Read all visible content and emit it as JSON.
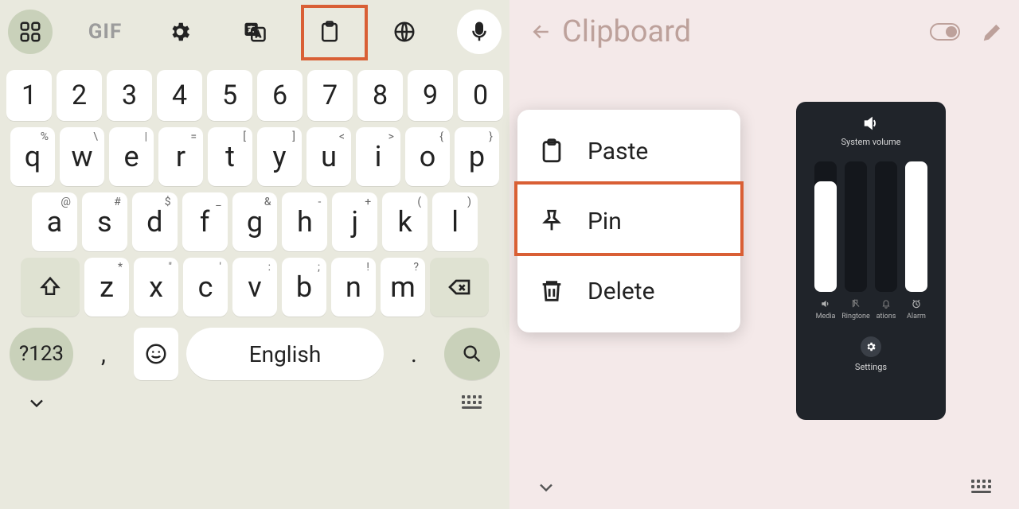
{
  "toolbar": {
    "gif_label": "GIF"
  },
  "keyboard": {
    "row1": [
      "1",
      "2",
      "3",
      "4",
      "5",
      "6",
      "7",
      "8",
      "9",
      "0"
    ],
    "row2": [
      {
        "k": "q",
        "h": "%"
      },
      {
        "k": "w",
        "h": "\\"
      },
      {
        "k": "e",
        "h": "|"
      },
      {
        "k": "r",
        "h": "="
      },
      {
        "k": "t",
        "h": "["
      },
      {
        "k": "y",
        "h": "]"
      },
      {
        "k": "u",
        "h": "<"
      },
      {
        "k": "i",
        "h": ">"
      },
      {
        "k": "o",
        "h": "{"
      },
      {
        "k": "p",
        "h": "}"
      }
    ],
    "row3": [
      {
        "k": "a",
        "h": "@"
      },
      {
        "k": "s",
        "h": "#"
      },
      {
        "k": "d",
        "h": "$"
      },
      {
        "k": "f",
        "h": "_"
      },
      {
        "k": "g",
        "h": "&"
      },
      {
        "k": "h",
        "h": "-"
      },
      {
        "k": "j",
        "h": "+"
      },
      {
        "k": "k",
        "h": "("
      },
      {
        "k": "l",
        "h": ")"
      }
    ],
    "row4": [
      {
        "k": "z",
        "h": "*"
      },
      {
        "k": "x",
        "h": "\""
      },
      {
        "k": "c",
        "h": "'"
      },
      {
        "k": "v",
        "h": ":"
      },
      {
        "k": "b",
        "h": ";"
      },
      {
        "k": "n",
        "h": "!"
      },
      {
        "k": "m",
        "h": "?"
      }
    ],
    "mode_label": "?123",
    "comma": ",",
    "period": ".",
    "space_label": "English"
  },
  "clipboard": {
    "title": "Clipboard",
    "menu": {
      "paste": "Paste",
      "pin": "Pin",
      "delete": "Delete"
    }
  },
  "volume": {
    "title": "System volume",
    "settings_label": "Settings",
    "sliders": [
      {
        "name": "Media",
        "level": 0.85
      },
      {
        "name": "Ringtone",
        "level": 0.0
      },
      {
        "name": "ations",
        "level": 0.0
      },
      {
        "name": "Alarm",
        "level": 1.0
      }
    ]
  }
}
